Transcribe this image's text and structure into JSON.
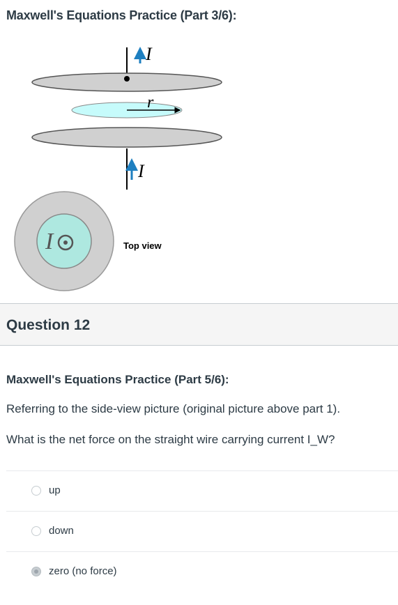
{
  "top_title": "Maxwell's Equations Practice (Part 3/6):",
  "figure": {
    "side_view": {
      "current_label_top": "I",
      "radius_label": "r",
      "current_label_bottom": "I"
    },
    "top_view": {
      "center_label": "I",
      "caption": "Top view"
    },
    "colors": {
      "plate": "#d0d0d0",
      "inner_disk": "#c6fbfb",
      "arrow": "#1e7fc0"
    }
  },
  "question": {
    "header": "Question 12",
    "subtitle": "Maxwell's Equations Practice (Part 5/6):",
    "line1": "Referring to the side-view picture (original picture above part 1).",
    "line2": "What is the net force on the straight wire carrying current I_W?",
    "answers": [
      {
        "label": "up",
        "selected": false
      },
      {
        "label": "down",
        "selected": false
      },
      {
        "label": "zero (no force)",
        "selected": true
      }
    ]
  }
}
